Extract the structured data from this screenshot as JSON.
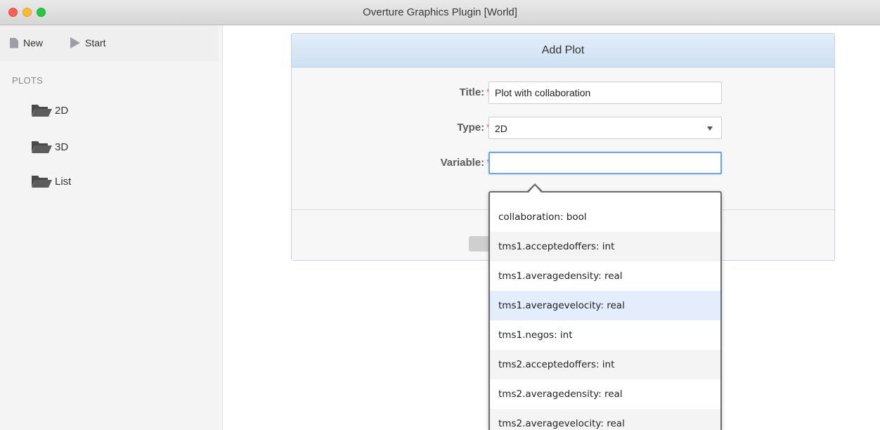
{
  "window": {
    "title": "Overture Graphics Plugin [World]"
  },
  "toolbar": {
    "new_label": "New",
    "start_label": "Start"
  },
  "sidebar": {
    "section_label": "PLOTS",
    "items": [
      {
        "label": "2D",
        "icon": "folder-icon"
      },
      {
        "label": "3D",
        "icon": "folder-icon"
      },
      {
        "label": "List",
        "icon": "folder-icon"
      }
    ]
  },
  "dialog": {
    "title": "Add Plot",
    "title_label": "Title:",
    "title_value": "Plot with collaboration",
    "type_label": "Type:",
    "type_value": "2D",
    "variable_label": "Variable:",
    "variable_value": "",
    "required_mark": "*"
  },
  "autocomplete": {
    "options": [
      "collaboration: bool",
      "tms1.acceptedoffers: int",
      "tms1.averagedensity: real",
      "tms1.averagevelocity: real",
      "tms1.negos: int",
      "tms2.acceptedoffers: int",
      "tms2.averagedensity: real",
      "tms2.averagevelocity: real"
    ],
    "hovered_index": 3
  },
  "colors": {
    "header_blue": "#cfe0f1",
    "focus_blue": "#6fa6e6",
    "required_red": "#d9534f",
    "hover_row": "#e3edfb"
  }
}
